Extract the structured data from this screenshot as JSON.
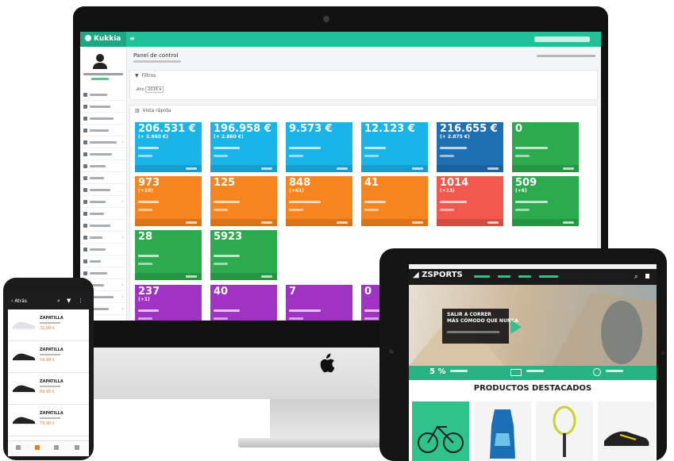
{
  "dashboard": {
    "logo_text": "Kukkia",
    "page_title": "Panel de control",
    "filters_label": "Filtros",
    "year_label": "Año",
    "year_value": "2016",
    "quick_view_label": "Vista rápida",
    "tiles_row1": [
      {
        "value": "206.531 €",
        "delta": "(+ 2.860 €)",
        "color": "#19b4e8"
      },
      {
        "value": "196.958 €",
        "delta": "(+ 2.860 €)",
        "color": "#19b4e8"
      },
      {
        "value": "9.573 €",
        "delta": "",
        "color": "#19b4e8"
      },
      {
        "value": "12.123 €",
        "delta": "",
        "color": "#19b4e8"
      },
      {
        "value": "216.655 €",
        "delta": "(+ 2.875 €)",
        "color": "#1f6fb3"
      },
      {
        "value": "0",
        "delta": "",
        "color": "#2bab4e"
      }
    ],
    "tiles_row2": [
      {
        "value": "973",
        "delta": "(+10)",
        "color": "#f7851f"
      },
      {
        "value": "125",
        "delta": "",
        "color": "#f7851f"
      },
      {
        "value": "848",
        "delta": "(+61)",
        "color": "#f7851f"
      },
      {
        "value": "41",
        "delta": "",
        "color": "#f7851f"
      },
      {
        "value": "1014",
        "delta": "(+13)",
        "color": "#f2584d"
      },
      {
        "value": "509",
        "delta": "(+6)",
        "color": "#2bab4e"
      }
    ],
    "tiles_row3": [
      {
        "value": "28",
        "delta": "",
        "color": "#2bab4e"
      },
      {
        "value": "5923",
        "delta": "",
        "color": "#2bab4e"
      }
    ],
    "tiles_row4": [
      {
        "value": "237",
        "delta": "(+1)",
        "color": "#a032c4"
      },
      {
        "value": "40",
        "delta": "",
        "color": "#a032c4"
      },
      {
        "value": "7",
        "delta": "",
        "color": "#a032c4"
      },
      {
        "value": "0",
        "delta": "",
        "color": "#a032c4"
      }
    ]
  },
  "tablet": {
    "brand": "ZSPORTS",
    "hero_line1": "SALIR A CORRER",
    "hero_line2": "MÁS CÓMODO QUE NUNCA",
    "feature_percent": "5 %",
    "featured_title": "PRODUCTOS DESTACADOS"
  },
  "phone": {
    "back_label": "Atrás",
    "products": [
      {
        "brand": "ZAPATILLA",
        "price": "32,00 €"
      },
      {
        "brand": "ZAPATILLA",
        "price": "59,99 €"
      },
      {
        "brand": "ZAPATILLA",
        "price": "89,95 €"
      },
      {
        "brand": "ZAPATILLA",
        "price": "79,90 €"
      }
    ]
  }
}
